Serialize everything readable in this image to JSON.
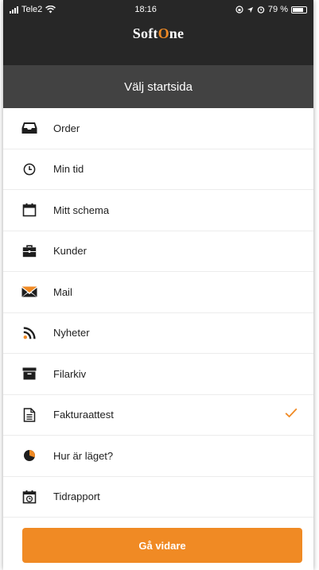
{
  "status_bar": {
    "carrier": "Tele2",
    "time": "18:16",
    "battery": "79 %"
  },
  "brand": {
    "text_a": "Soft",
    "text_b": "O",
    "text_c": "ne"
  },
  "header": {
    "title": "Välj startsida"
  },
  "menu": {
    "items": [
      {
        "label": "Order",
        "icon": "inbox-tray-icon"
      },
      {
        "label": "Min tid",
        "icon": "clock-icon"
      },
      {
        "label": "Mitt schema",
        "icon": "calendar-icon"
      },
      {
        "label": "Kunder",
        "icon": "briefcase-icon"
      },
      {
        "label": "Mail",
        "icon": "envelope-icon"
      },
      {
        "label": "Nyheter",
        "icon": "rss-icon"
      },
      {
        "label": "Filarkiv",
        "icon": "archive-box-icon"
      },
      {
        "label": "Fakturaattest",
        "icon": "document-icon",
        "selected": true
      },
      {
        "label": "Hur är läget?",
        "icon": "pie-chart-icon"
      },
      {
        "label": "Tidrapport",
        "icon": "calendar-clock-icon"
      }
    ]
  },
  "footer": {
    "continue_label": "Gå vidare"
  },
  "colors": {
    "accent": "#f08a24",
    "topbar": "#272727",
    "subhead": "#424242"
  }
}
